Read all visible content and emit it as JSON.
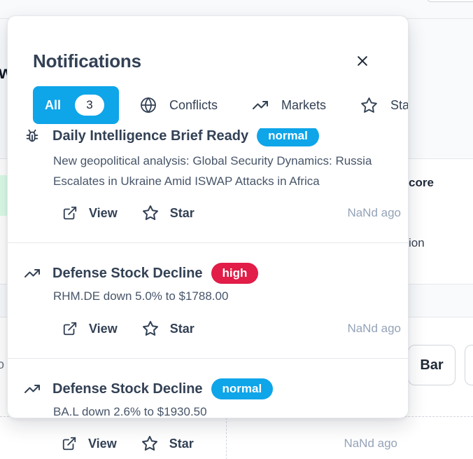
{
  "background": {
    "partial_heading": "w",
    "partial_left_text": "o",
    "partial_core": "core",
    "partial_ion": "ion",
    "bar_button": "Bar"
  },
  "popover": {
    "title": "Notifications",
    "tabs": [
      {
        "label": "All",
        "count": "3",
        "active": true,
        "icon": "none"
      },
      {
        "label": "Conflicts",
        "icon": "globe-icon"
      },
      {
        "label": "Markets",
        "icon": "trending-up-icon"
      },
      {
        "label": "Starred",
        "icon": "star-icon"
      }
    ],
    "notifications": [
      {
        "icon": "bug-icon",
        "title": "Daily Intelligence Brief Ready",
        "severity": "normal",
        "description": "New geopolitical analysis: Global Security Dynamics: Russia Escalates in Ukraine Amid ISWAP Attacks in Africa",
        "view_label": "View",
        "star_label": "Star",
        "time_ago": "NaNd ago"
      },
      {
        "icon": "trending-up-icon",
        "title": "Defense Stock Decline",
        "severity": "high",
        "description": "RHM.DE down 5.0% to $1788.00",
        "view_label": "View",
        "star_label": "Star",
        "time_ago": "NaNd ago"
      },
      {
        "icon": "trending-up-icon",
        "title": "Defense Stock Decline",
        "severity": "normal",
        "description": "BA.L down 2.6% to $1930.50",
        "view_label": "View",
        "star_label": "Star",
        "time_ago": "NaNd ago"
      }
    ]
  },
  "colors": {
    "accent": "#0ea5e9",
    "high": "#e11d48",
    "muted": "#94a3b8"
  }
}
